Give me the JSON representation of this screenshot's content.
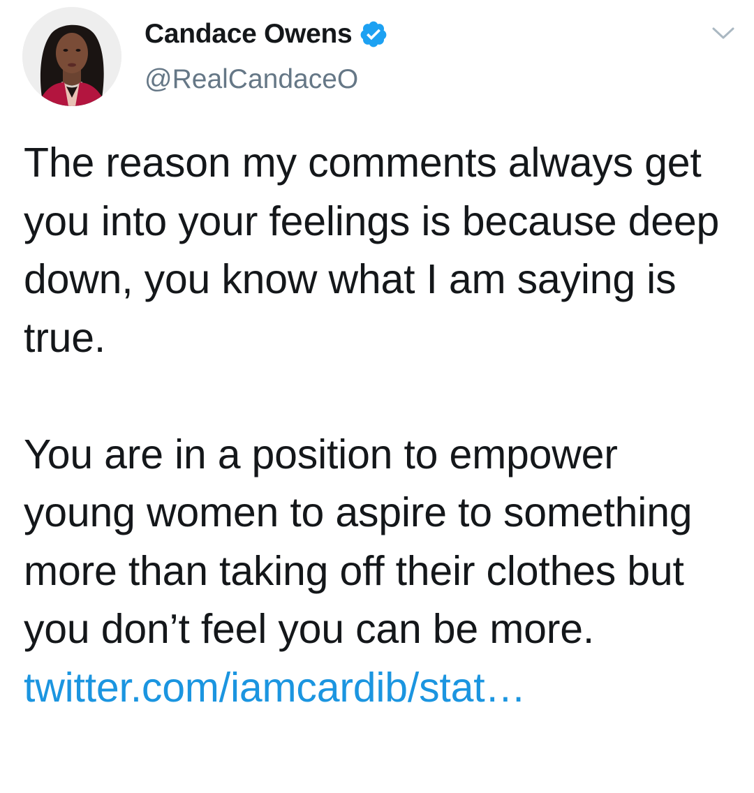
{
  "author": {
    "display_name": "Candace Owens",
    "handle": "@RealCandaceO",
    "verified_icon": "verified-badge-icon",
    "avatar": "profile-photo"
  },
  "menu_icon": "chevron-down-icon",
  "tweet": {
    "paragraph_1": "The reason my comments always get you into your feelings is because deep down, you know what I am saying is true.",
    "paragraph_2_text": "You are in a position to empower young women to aspire to something more than taking off their clothes but you don’t feel you can be more.",
    "link_text": "twitter.com/iamcardib/stat…"
  },
  "colors": {
    "text": "#14171a",
    "secondary": "#657786",
    "link": "#1b95e0",
    "verified": "#1da1f2"
  }
}
